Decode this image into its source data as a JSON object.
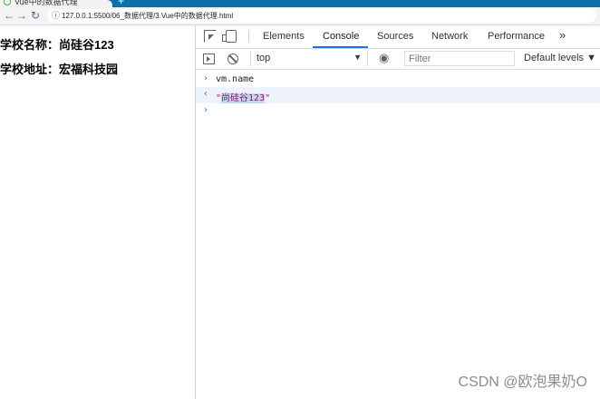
{
  "browser": {
    "tab_title": "Vue中的数据代理",
    "url": "127.0.0.1:5500/06_数据代理/3.Vue中的数据代理.html",
    "new_tab_label": "+"
  },
  "page": {
    "school_name_line": "学校名称：尚硅谷123",
    "school_address_line": "学校地址：宏福科技园"
  },
  "devtools": {
    "tabs": [
      "Elements",
      "Console",
      "Sources",
      "Network",
      "Performance"
    ],
    "active_tab": "Console",
    "more_tabs": "»",
    "context": "top",
    "filter_placeholder": "Filter",
    "levels_label": "Default levels ▼",
    "console": {
      "input_command": "vm.name",
      "result_value": "尚硅谷123",
      "quote": "\""
    }
  },
  "watermark": "CSDN @欧泡果奶O",
  "colors": {
    "tab_bar": "#0b6fa8",
    "active_tab_underline": "#1a73e8",
    "result_row_bg": "#eef3fb",
    "string_color": "#8a1c5c"
  }
}
